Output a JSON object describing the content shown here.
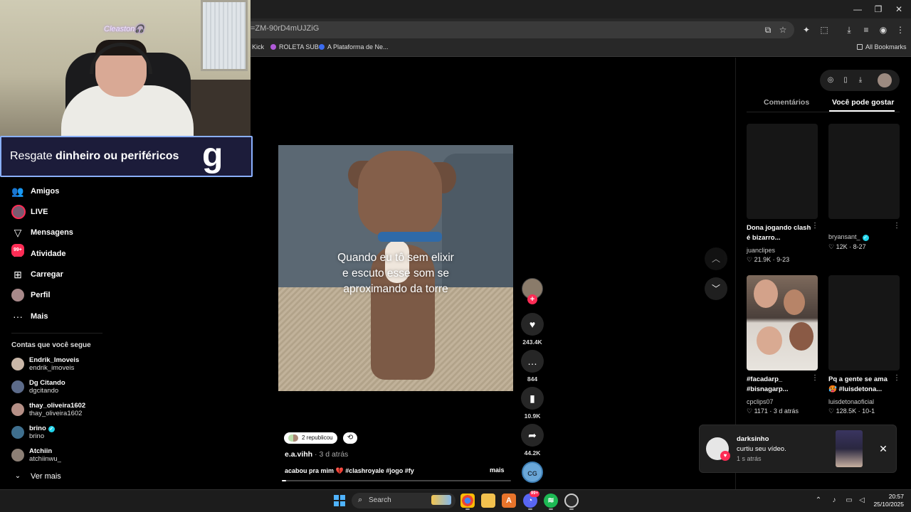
{
  "browser": {
    "url_fragment": "=ZM-90rD4mUJZiG",
    "bookmarks": [
      "Kick",
      "ROLETA SUB",
      "A Plataforma de Ne...",
      "All Bookmarks"
    ],
    "window_controls": [
      "—",
      "❐",
      "✕"
    ]
  },
  "webcam": {
    "streamer_tag": "Cleaston🎧",
    "promo_prefix": "Resgate ",
    "promo_bold": "dinheiro ou periféricos",
    "promo_logo": "g"
  },
  "sidebar": {
    "items": [
      {
        "label": "Amigos",
        "icon": "friends-icon"
      },
      {
        "label": "LIVE",
        "icon": "live-avatar"
      },
      {
        "label": "Mensagens",
        "icon": "messages-icon"
      },
      {
        "label": "Atividade",
        "icon": "activity-icon",
        "badge": "99+"
      },
      {
        "label": "Carregar",
        "icon": "upload-icon"
      },
      {
        "label": "Perfil",
        "icon": "profile-avatar"
      },
      {
        "label": "Mais",
        "icon": "more-icon"
      }
    ],
    "following_title": "Contas que você segue",
    "following": [
      {
        "name": "Endrik_Imoveis",
        "handle": "endrik_imoveis",
        "verified": false,
        "color": "#c9b7a8"
      },
      {
        "name": "Dg Citando",
        "handle": "dgcitando",
        "verified": false,
        "color": "#5c6b8a"
      },
      {
        "name": "thay_oliveira1602",
        "handle": "thay_oliveira1602",
        "verified": false,
        "color": "#b58f86"
      },
      {
        "name": "brino",
        "handle": "brino",
        "verified": true,
        "color": "#3f6f8e"
      },
      {
        "name": "Atchiin",
        "handle": "atchiinwu_",
        "verified": false,
        "color": "#8c7f75"
      }
    ],
    "see_more": "Ver mais"
  },
  "video": {
    "caption_lines": [
      "Quando eu tô sem elixir",
      "e escuto esse som se",
      "aproximando da torre"
    ],
    "repost_label": "2 republicou",
    "author": "e.a.vihh",
    "time": " · 3 d atrás",
    "description": "acabou pra mim 💔 #clashroyale #jogo #fy",
    "more_label": "mais",
    "progress": 0.02,
    "likes": "243.4K",
    "comments": "844",
    "saves": "10.9K",
    "shares": "44.2K",
    "cg_label": "CG"
  },
  "right_panel": {
    "tabs": [
      "Comentários",
      "Você pode gostar"
    ],
    "active_tab": 1,
    "cards": [
      {
        "title": "Dona jogando clash é bizarro...",
        "user": "juanclipes",
        "stats": "♡ 21.9K · 9-23",
        "verified": false
      },
      {
        "title": "",
        "user": "bryansant_",
        "stats": "♡ 12K · 8-27",
        "verified": true
      },
      {
        "title": "#facadarp_ #bisnagarp...",
        "user": "cpclips07",
        "stats": "♡ 1171 · 3 d atrás",
        "verified": false
      },
      {
        "title": "Pq a gente se ama 🥵 #luisdetona...",
        "user": "luisdetonaoficial",
        "stats": "♡ 128.5K · 10-1",
        "verified": false
      }
    ]
  },
  "notification": {
    "name": "darksinho",
    "message": "curtiu seu vídeo.",
    "time": "1 s atrás"
  },
  "taskbar": {
    "search_label": "Search",
    "notif_badge": "99+",
    "time": "20:57",
    "date": "25/10/2025"
  }
}
